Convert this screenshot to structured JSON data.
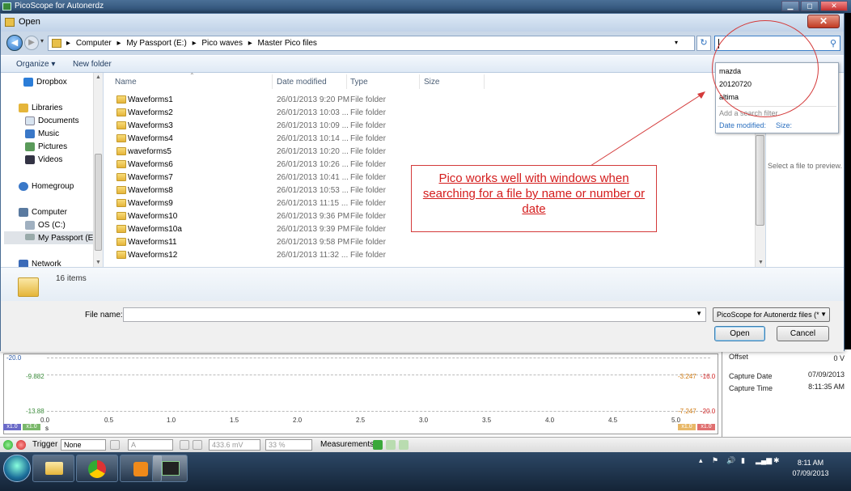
{
  "app": {
    "title": "PicoScope for Autonerdz",
    "win_min": "▁",
    "win_max": "◻",
    "win_close": "✕"
  },
  "dialog": {
    "title": "Open",
    "close": "✕",
    "breadcrumbs": [
      "Computer",
      "My Passport (E:)",
      "Pico waves",
      "Master Pico files"
    ],
    "crumb_sep": "▸",
    "search_value": "",
    "commands": {
      "organize": "Organize ▾",
      "new_folder": "New folder"
    },
    "nav": [
      {
        "label": "Dropbox",
        "icon": "dropbox-icon"
      },
      {
        "label": "Libraries",
        "icon": "libraries-icon"
      },
      {
        "label": "Documents",
        "icon": "documents-icon"
      },
      {
        "label": "Music",
        "icon": "music-icon"
      },
      {
        "label": "Pictures",
        "icon": "pictures-icon"
      },
      {
        "label": "Videos",
        "icon": "videos-icon"
      },
      {
        "label": "Homegroup",
        "icon": "homegroup-icon"
      },
      {
        "label": "Computer",
        "icon": "computer-icon"
      },
      {
        "label": "OS (C:)",
        "icon": "drive-icon"
      },
      {
        "label": "My Passport (E:)",
        "icon": "usb-drive-icon"
      },
      {
        "label": "Network",
        "icon": "network-icon"
      }
    ],
    "columns": {
      "name": "Name",
      "date": "Date modified",
      "type": "Type",
      "size": "Size"
    },
    "files": [
      {
        "name": "Waveforms1",
        "date": "26/01/2013 9:20 PM",
        "type": "File folder"
      },
      {
        "name": "Waveforms2",
        "date": "26/01/2013 10:03 ...",
        "type": "File folder"
      },
      {
        "name": "Waveforms3",
        "date": "26/01/2013 10:09 ...",
        "type": "File folder"
      },
      {
        "name": "Waveforms4",
        "date": "26/01/2013 10:14 ...",
        "type": "File folder"
      },
      {
        "name": "waveforms5",
        "date": "26/01/2013 10:20 ...",
        "type": "File folder"
      },
      {
        "name": "Waveforms6",
        "date": "26/01/2013 10:26 ...",
        "type": "File folder"
      },
      {
        "name": "Waveforms7",
        "date": "26/01/2013 10:41 ...",
        "type": "File folder"
      },
      {
        "name": "Waveforms8",
        "date": "26/01/2013 10:53 ...",
        "type": "File folder"
      },
      {
        "name": "Waveforms9",
        "date": "26/01/2013 11:15 ...",
        "type": "File folder"
      },
      {
        "name": "Waveforms10",
        "date": "26/01/2013 9:36 PM",
        "type": "File folder"
      },
      {
        "name": "Waveforms10a",
        "date": "26/01/2013 9:39 PM",
        "type": "File folder"
      },
      {
        "name": "Waveforms11",
        "date": "26/01/2013 9:58 PM",
        "type": "File folder"
      },
      {
        "name": "Waveforms12",
        "date": "26/01/2013 11:32 ...",
        "type": "File folder"
      }
    ],
    "preview_text": "Select a file to preview.",
    "items_count": "16 items",
    "file_name_label": "File name:",
    "file_name_value": "",
    "file_type": "PicoScope for Autonerdz files (*",
    "open_label": "Open",
    "cancel_label": "Cancel",
    "suggestions": [
      "mazda",
      "20120720",
      "altima"
    ],
    "search_hint": "Add a search filter",
    "filters": [
      "Date modified:",
      "Size:"
    ]
  },
  "annotation": {
    "text": "Pico works well with windows when searching for a file by name or number or date"
  },
  "scope": {
    "y_left": [
      "-20.0",
      "-9.882",
      "-13.88"
    ],
    "y_right": [
      "-3.247",
      "-16.0",
      "-7.247",
      "-20.0"
    ],
    "x_ticks": [
      "0.0",
      "0.5",
      "1.0",
      "1.5",
      "2.0",
      "2.5",
      "3.0",
      "3.5",
      "4.0",
      "4.5",
      "5.0"
    ],
    "x_unit": "s",
    "chips": [
      "x1.0",
      "x1.0",
      "x1.0",
      "x1.0"
    ],
    "props": [
      {
        "label": "Offset",
        "value": "0 V"
      },
      {
        "label": "Capture Date",
        "value": "07/09/2013"
      },
      {
        "label": "Capture Time",
        "value": "8:11:35 AM"
      }
    ],
    "toolbar": {
      "trigger": "Trigger",
      "trigger_mode": "None",
      "channel": "A",
      "threshold": "433.6 mV",
      "pre_trigger": "33 %",
      "measurements": "Measurements"
    }
  },
  "taskbar": {
    "time": "8:11 AM",
    "date": "07/09/2013"
  },
  "colors": {
    "annotation_red": "#d41c1c",
    "search_accent": "#3c7fc8",
    "folder_yellow": "#e5b53a"
  }
}
